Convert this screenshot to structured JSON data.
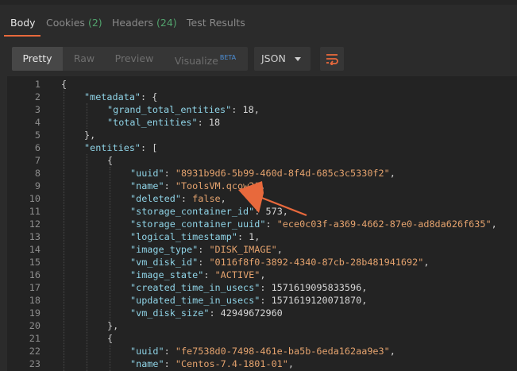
{
  "tabs": [
    {
      "label": "Body",
      "count": ""
    },
    {
      "label": "Cookies",
      "count": "(2)"
    },
    {
      "label": "Headers",
      "count": "(24)"
    },
    {
      "label": "Test Results",
      "count": ""
    }
  ],
  "view_modes": [
    "Pretty",
    "Raw",
    "Preview",
    "Visualize"
  ],
  "visualize_badge": "BETA",
  "format_dropdown": {
    "selected": "JSON"
  },
  "icons": {
    "wrap": "wrap-lines-icon",
    "dropdown": "chevron-down-icon",
    "annotation": "arrow-annotation"
  },
  "colors": {
    "accent": "#e8693c",
    "key": "#8fd3e6",
    "string": "#e5a36e",
    "count": "#52a36d",
    "beta": "#4d8fd6"
  },
  "code": {
    "line_numbers": [
      "1",
      "2",
      "3",
      "4",
      "5",
      "6",
      "7",
      "8",
      "9",
      "10",
      "11",
      "12",
      "13",
      "14",
      "15",
      "16",
      "17",
      "18",
      "19",
      "20",
      "21",
      "22",
      "23"
    ],
    "lines": [
      [
        {
          "t": "{",
          "c": "p"
        }
      ],
      [
        {
          "t": "\"metadata\"",
          "c": "k"
        },
        {
          "t": ": {",
          "c": "p"
        }
      ],
      [
        {
          "t": "\"grand_total_entities\"",
          "c": "k"
        },
        {
          "t": ": ",
          "c": "p"
        },
        {
          "t": "18",
          "c": "n"
        },
        {
          "t": ",",
          "c": "p"
        }
      ],
      [
        {
          "t": "\"total_entities\"",
          "c": "k"
        },
        {
          "t": ": ",
          "c": "p"
        },
        {
          "t": "18",
          "c": "n"
        }
      ],
      [
        {
          "t": "},",
          "c": "p"
        }
      ],
      [
        {
          "t": "\"entities\"",
          "c": "k"
        },
        {
          "t": ": [",
          "c": "p"
        }
      ],
      [
        {
          "t": "{",
          "c": "p"
        }
      ],
      [
        {
          "t": "\"uuid\"",
          "c": "k"
        },
        {
          "t": ": ",
          "c": "p"
        },
        {
          "t": "\"8931b9d6-5b99-460d-8f4d-685c3c5330f2\"",
          "c": "s"
        },
        {
          "t": ",",
          "c": "p"
        }
      ],
      [
        {
          "t": "\"name\"",
          "c": "k"
        },
        {
          "t": ": ",
          "c": "p"
        },
        {
          "t": "\"ToolsVM.qcow2\"",
          "c": "s"
        },
        {
          "t": ",",
          "c": "p"
        }
      ],
      [
        {
          "t": "\"deleted\"",
          "c": "k"
        },
        {
          "t": ": ",
          "c": "p"
        },
        {
          "t": "false",
          "c": "s"
        },
        {
          "t": ",",
          "c": "p"
        }
      ],
      [
        {
          "t": "\"storage_container_id\"",
          "c": "k"
        },
        {
          "t": ": ",
          "c": "p"
        },
        {
          "t": "573",
          "c": "n"
        },
        {
          "t": ",",
          "c": "p"
        }
      ],
      [
        {
          "t": "\"storage_container_uuid\"",
          "c": "k"
        },
        {
          "t": ": ",
          "c": "p"
        },
        {
          "t": "\"ece0c03f-a369-4662-87e0-ad8da626f635\"",
          "c": "s"
        },
        {
          "t": ",",
          "c": "p"
        }
      ],
      [
        {
          "t": "\"logical_timestamp\"",
          "c": "k"
        },
        {
          "t": ": ",
          "c": "p"
        },
        {
          "t": "1",
          "c": "n"
        },
        {
          "t": ",",
          "c": "p"
        }
      ],
      [
        {
          "t": "\"image_type\"",
          "c": "k"
        },
        {
          "t": ": ",
          "c": "p"
        },
        {
          "t": "\"DISK_IMAGE\"",
          "c": "s"
        },
        {
          "t": ",",
          "c": "p"
        }
      ],
      [
        {
          "t": "\"vm_disk_id\"",
          "c": "k"
        },
        {
          "t": ": ",
          "c": "p"
        },
        {
          "t": "\"0116f8f0-3892-4340-87cb-28b481941692\"",
          "c": "s"
        },
        {
          "t": ",",
          "c": "p"
        }
      ],
      [
        {
          "t": "\"image_state\"",
          "c": "k"
        },
        {
          "t": ": ",
          "c": "p"
        },
        {
          "t": "\"ACTIVE\"",
          "c": "s"
        },
        {
          "t": ",",
          "c": "p"
        }
      ],
      [
        {
          "t": "\"created_time_in_usecs\"",
          "c": "k"
        },
        {
          "t": ": ",
          "c": "p"
        },
        {
          "t": "1571619095833596",
          "c": "n"
        },
        {
          "t": ",",
          "c": "p"
        }
      ],
      [
        {
          "t": "\"updated_time_in_usecs\"",
          "c": "k"
        },
        {
          "t": ": ",
          "c": "p"
        },
        {
          "t": "1571619120071870",
          "c": "n"
        },
        {
          "t": ",",
          "c": "p"
        }
      ],
      [
        {
          "t": "\"vm_disk_size\"",
          "c": "k"
        },
        {
          "t": ": ",
          "c": "p"
        },
        {
          "t": "42949672960",
          "c": "n"
        }
      ],
      [
        {
          "t": "},",
          "c": "p"
        }
      ],
      [
        {
          "t": "{",
          "c": "p"
        }
      ],
      [
        {
          "t": "\"uuid\"",
          "c": "k"
        },
        {
          "t": ": ",
          "c": "p"
        },
        {
          "t": "\"fe7538d0-7498-461e-ba5b-6eda162aa9e3\"",
          "c": "s"
        },
        {
          "t": ",",
          "c": "p"
        }
      ],
      [
        {
          "t": "\"name\"",
          "c": "k"
        },
        {
          "t": ": ",
          "c": "p"
        },
        {
          "t": "\"Centos-7.4-1801-01\"",
          "c": "s"
        },
        {
          "t": ",",
          "c": "p"
        }
      ]
    ]
  }
}
